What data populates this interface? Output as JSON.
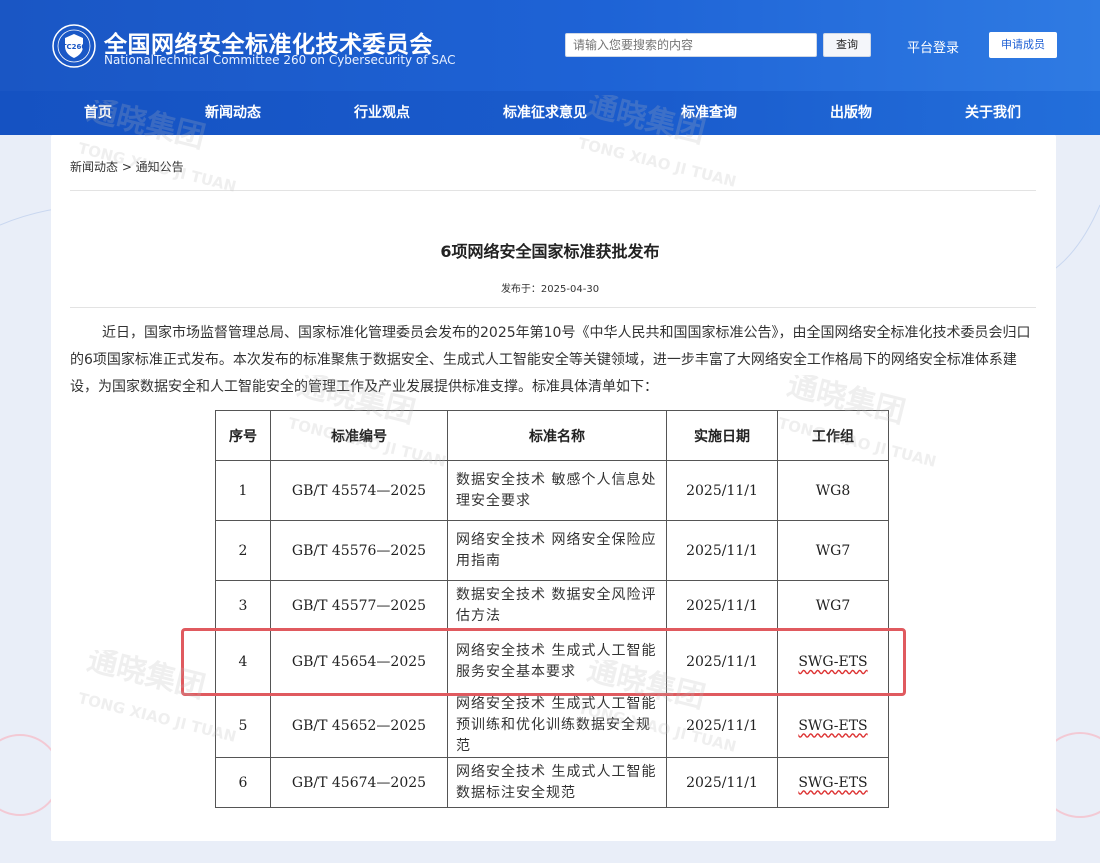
{
  "header": {
    "title": "全国网络安全标准化技术委员会",
    "subtitle": "NationalTechnical Committee 260 on Cybersecurity of SAC",
    "logo_text": "TC260",
    "search_placeholder": "请输入您要搜索的内容",
    "search_button": "查询",
    "login": "平台登录",
    "apply": "申请成员"
  },
  "nav": [
    "首页",
    "新闻动态",
    "行业观点",
    "标准征求意见",
    "标准查询",
    "出版物",
    "关于我们"
  ],
  "breadcrumb": "新闻动态 >  通知公告",
  "article": {
    "title": "6项网络安全国家标准获批发布",
    "date": "发布于：2025-04-30",
    "intro": "近日，国家市场监督管理总局、国家标准化管理委员会发布的2025年第10号《中华人民共和国国家标准公告》，由全国网络安全标准化技术委员会归口的6项国家标准正式发布。本次发布的标准聚焦于数据安全、生成式人工智能安全等关键领域，进一步丰富了大网络安全工作格局下的网络安全标准体系建设，为国家数据安全和人工智能安全的管理工作及产业发展提供标准支撑。标准具体清单如下："
  },
  "table": {
    "headers": [
      "序号",
      "标准编号",
      "标准名称",
      "实施日期",
      "工作组"
    ],
    "rows": [
      {
        "no": "1",
        "code": "GB/T 45574—2025",
        "name": "数据安全技术 敏感个人信息处理安全要求",
        "date": "2025/11/1",
        "wg": "WG8"
      },
      {
        "no": "2",
        "code": "GB/T 45576—2025",
        "name": "网络安全技术 网络安全保险应用指南",
        "date": "2025/11/1",
        "wg": "WG7"
      },
      {
        "no": "3",
        "code": "GB/T 45577—2025",
        "name": "数据安全技术 数据安全风险评估方法",
        "date": "2025/11/1",
        "wg": "WG7"
      },
      {
        "no": "4",
        "code": "GB/T 45654—2025",
        "name": "网络安全技术 生成式人工智能服务安全基本要求",
        "date": "2025/11/1",
        "wg": "SWG-ETS"
      },
      {
        "no": "5",
        "code": "GB/T 45652—2025",
        "name": "网络安全技术 生成式人工智能预训练和优化训练数据安全规范",
        "date": "2025/11/1",
        "wg": "SWG-ETS"
      },
      {
        "no": "6",
        "code": "GB/T 45674—2025",
        "name": "网络安全技术 生成式人工智能数据标注安全规范",
        "date": "2025/11/1",
        "wg": "SWG-ETS"
      }
    ]
  },
  "watermark": {
    "cn": "通晓集团",
    "en": "TONG XIAO JI TUAN"
  }
}
